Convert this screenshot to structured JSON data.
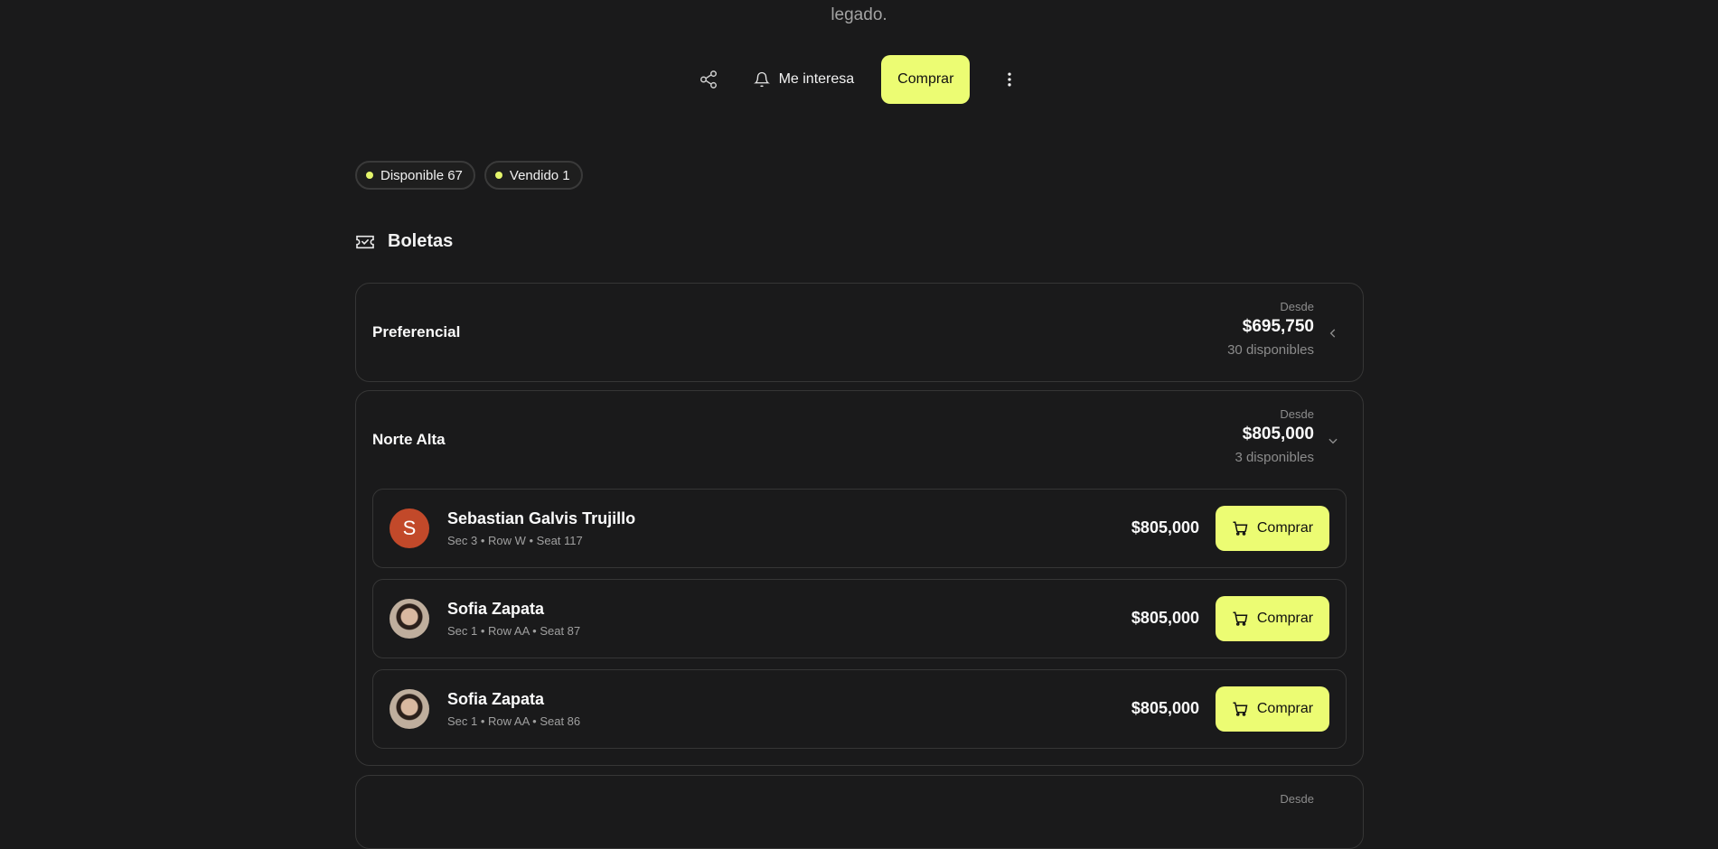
{
  "description": {
    "tail": "legado."
  },
  "actions": {
    "share_icon": "share-icon",
    "interest_label": "Me interesa",
    "buy_label": "Comprar",
    "more_icon": "more-vertical-icon"
  },
  "badges": [
    {
      "label": "Disponible 67"
    },
    {
      "label": "Vendido 1"
    }
  ],
  "section": {
    "title": "Boletas",
    "icon": "ticket-icon"
  },
  "categories": [
    {
      "name": "Preferencial",
      "desde": "Desde",
      "price": "$695,750",
      "available": "30 disponibles",
      "expanded": false
    },
    {
      "name": "Norte Alta",
      "desde": "Desde",
      "price": "$805,000",
      "available": "3 disponibles",
      "expanded": true
    },
    {
      "desde": "Desde"
    }
  ],
  "listings": [
    {
      "initial": "S",
      "name": "Sebastian Galvis Trujillo",
      "seat": "Sec 3 • Row W • Seat 117",
      "price": "$805,000",
      "buy": "Comprar"
    },
    {
      "name": "Sofia Zapata",
      "seat": "Sec 1 • Row AA • Seat 87",
      "price": "$805,000",
      "buy": "Comprar"
    },
    {
      "name": "Sofia Zapata",
      "seat": "Sec 1 • Row AA • Seat 86",
      "price": "$805,000",
      "buy": "Comprar"
    }
  ],
  "colors": {
    "accent": "#ecfc73",
    "background": "#1a1a1b",
    "avatar_letter": "#c2492a"
  }
}
